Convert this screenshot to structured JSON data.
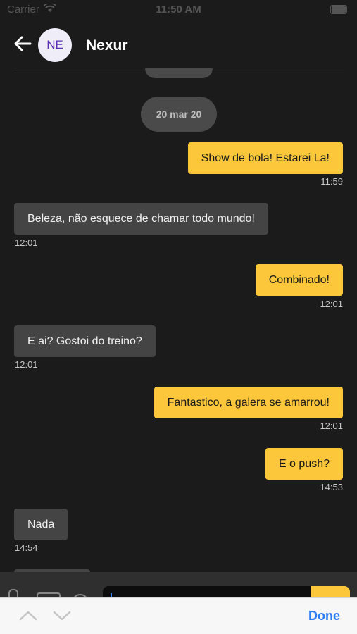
{
  "status_bar": {
    "carrier": "Carrier",
    "time": "11:50 AM"
  },
  "header": {
    "avatar_initials": "NE",
    "contact_name": "Nexur"
  },
  "date_separator": "20 mar 20",
  "messages": [
    {
      "direction": "out",
      "text": "Show de bola! Estarei La!",
      "time": "11:59"
    },
    {
      "direction": "in",
      "text": "Beleza, não esquece de chamar todo mundo!",
      "time": "12:01"
    },
    {
      "direction": "out",
      "text": "Combinado!",
      "time": "12:01"
    },
    {
      "direction": "in",
      "text": "E ai? Gostoi do treino?",
      "time": "12:01"
    },
    {
      "direction": "out",
      "text": "Fantastico, a galera se amarrou!",
      "time": "12:01"
    },
    {
      "direction": "out",
      "text": "E o push?",
      "time": "14:53"
    },
    {
      "direction": "in",
      "text": "Nada",
      "time": "14:54"
    }
  ],
  "keyboard_toolbar": {
    "done_label": "Done"
  },
  "colors": {
    "outgoing_bubble": "#fcc73b",
    "incoming_bubble": "#444444",
    "background": "#1b1b1b",
    "accent": "#2f7df6"
  }
}
